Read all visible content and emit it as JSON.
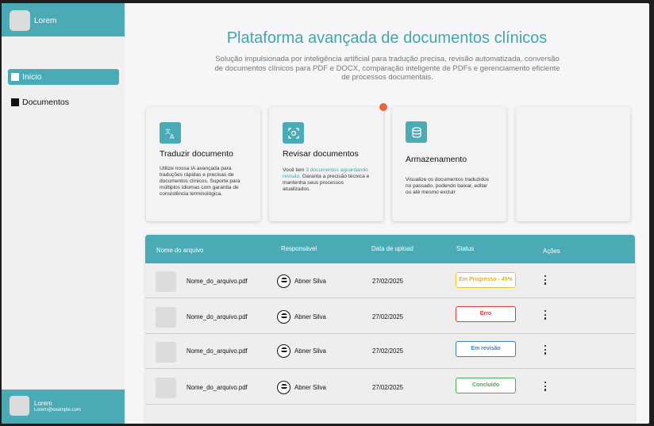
{
  "sidebar": {
    "brand": "Lorem",
    "nav": [
      {
        "label": "Inicio",
        "icon": "square-icon",
        "active": true
      },
      {
        "label": "Documentos",
        "icon": "square-icon",
        "active": false
      }
    ],
    "user": {
      "name": "Lorem",
      "email": "Lorem@example.com"
    }
  },
  "hero": {
    "title": "Plataforma avançada de documentos clínicos",
    "subtitle": "Solução impulsionada por inteligência artificial para tradução precisa, revisão automatizada, conversão de documentos clínicos para PDF e DOCX, comparação inteligente de PDFs e gerenciamento eficiente de processos documentais."
  },
  "cards": [
    {
      "title": "Traduzir documento",
      "icon": "translate-icon",
      "desc": "Utilize nossa IA avançada para traduções rápidas e precisas de documentos clínicos. Suporte para múltiplos idiomas com garantia de consistência terminológica."
    },
    {
      "title": "Revisar documentos",
      "icon": "scan-icon",
      "desc_pre": "Você tem ",
      "desc_highlight": "3 documentos aguardando revisão",
      "desc_post": ". Garanta a precisão técnica e mantenha seus processos atualizados."
    },
    {
      "title": "Armazenamento",
      "icon": "database-icon",
      "desc": "Visualize os documentos traduzidos no passado, podendo baixar, editar ou até mesmo excluir"
    }
  ],
  "table": {
    "headers": {
      "file": "Nome do arquivo",
      "owner": "Responsável",
      "date": "Data de upload",
      "status": "Status",
      "actions": "Ações"
    },
    "rows": [
      {
        "file": "Nome_do_arquivo.pdf",
        "owner": "Abner Silva",
        "date": "27/02/2025",
        "status": "Em Progresso - 45%",
        "progress": 45
      },
      {
        "file": "Nome_do_arquivo.pdf",
        "owner": "Abner Silva",
        "date": "27/02/2025",
        "status": "Erro"
      },
      {
        "file": "Nome_do_arquivo.pdf",
        "owner": "Abner Silva",
        "date": "27/02/2025",
        "status": "Em revisão"
      },
      {
        "file": "Nome_do_arquivo.pdf",
        "owner": "Abner Silva",
        "date": "27/02/2025",
        "status": "Concluído"
      }
    ]
  },
  "colors": {
    "accent": "#4aaab5",
    "title": "#3ea7b1",
    "status_progress": "#f2c230",
    "status_error": "#e23b3b",
    "status_review": "#3a7fd5",
    "status_done": "#3fb04a",
    "notification": "#e8663a"
  }
}
